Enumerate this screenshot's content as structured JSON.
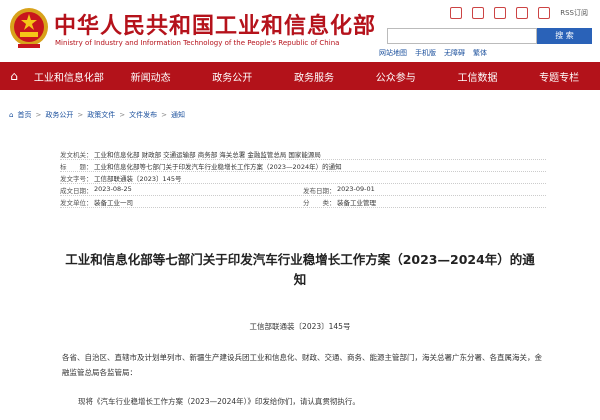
{
  "header": {
    "title": "中华人民共和国工业和信息化部",
    "subtitle": "Ministry of Industry and Information Technology of the People's Republic of China",
    "rss": "RSS订阅",
    "quick_links": [
      "网站地图",
      "手机版",
      "无障碍",
      "繁体"
    ],
    "search_button": "搜 索"
  },
  "nav": {
    "items": [
      "工业和信息化部",
      "新闻动态",
      "政务公开",
      "政务服务",
      "公众参与",
      "工信数据",
      "专题专栏"
    ]
  },
  "breadcrumb": [
    "首页",
    "政务公开",
    "政策文件",
    "文件发布",
    "通知"
  ],
  "meta": {
    "issuer_label": "发文机关：",
    "issuer": "工业和信息化部 财政部 交通运输部 商务部 海关总署 金融监管总局 国家能源局",
    "title_label": "标　　题：",
    "title": "工业和信息化部等七部门关于印发汽车行业稳增长工作方案（2023—2024年）的通知",
    "number_label": "发文字号：",
    "number": "工信部联通装〔2023〕145号",
    "written_label": "成文日期：",
    "written": "2023-08-25",
    "published_label": "发布日期：",
    "published": "2023-09-01",
    "source_label": "发文单位：",
    "source": "装备工业一司",
    "category_label": "分　　类：",
    "category": "装备工业管理"
  },
  "document": {
    "title": "工业和信息化部等七部门关于印发汽车行业稳增长工作方案（2023—2024年）的通知",
    "number": "工信部联通装〔2023〕145号",
    "addressees": "各省、自治区、直辖市及计划单列市、新疆生产建设兵团工业和信息化、财政、交通、商务、能源主管部门，海关总署广东分署、各直属海关，金融监管总局各监管局：",
    "body": "现将《汽车行业稳增长工作方案（2023—2024年）》印发给你们，请认真贯彻执行。"
  },
  "colors": {
    "brand_red": "#b3121a",
    "link_blue": "#1a4f9c",
    "search_blue": "#2a62b8"
  }
}
